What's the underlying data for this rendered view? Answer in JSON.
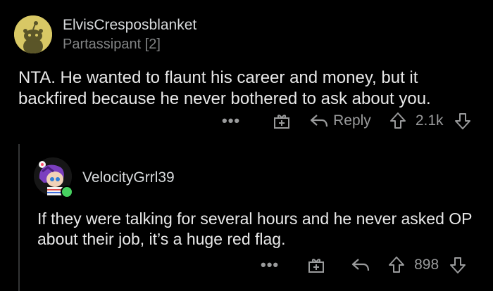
{
  "comment": {
    "username": "ElvisCresposblanket",
    "flair": "Partassipant [2]",
    "body": "NTA. He wanted to flaunt his career and money, but it backfired because he never bothered to ask about you.",
    "actions": {
      "more_label": "•••",
      "reply_label": "Reply",
      "score": "2.1k"
    },
    "icons": [
      "snoo-avatar-icon",
      "more-icon",
      "award-icon",
      "reply-icon",
      "upvote-icon",
      "downvote-icon"
    ]
  },
  "reply": {
    "username": "VelocityGrrl39",
    "body": "If they were talking for several hours and he never asked OP about their job, it’s a huge red flag.",
    "actions": {
      "more_label": "•••",
      "score": "898"
    },
    "icons": [
      "avatar-icon",
      "online-status-icon",
      "more-icon",
      "award-icon",
      "reply-icon",
      "upvote-icon",
      "downvote-icon"
    ]
  },
  "colors": {
    "background": "#000000",
    "text": "#d7dadc",
    "meta": "#818384",
    "online": "#46d160",
    "avatar_bg": "#d8c865"
  }
}
